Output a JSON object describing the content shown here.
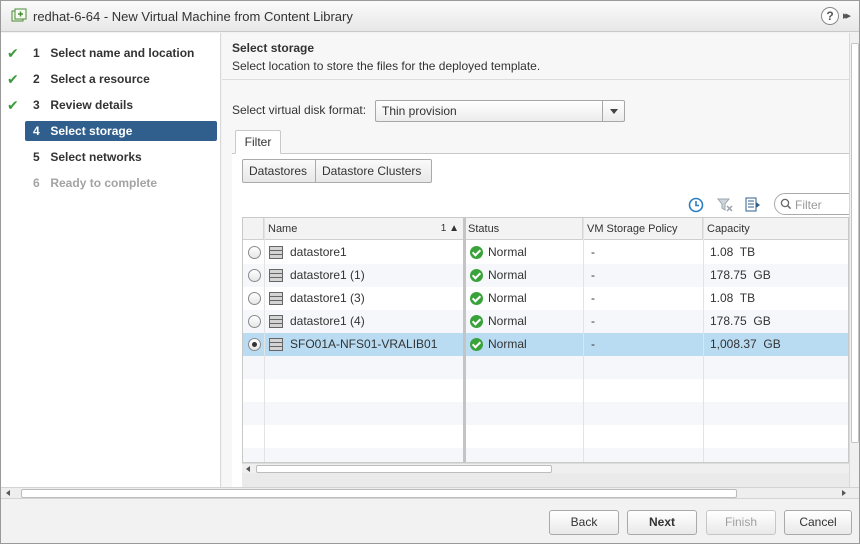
{
  "window": {
    "title": "redhat-6-64 - New Virtual Machine from Content Library",
    "help": "?",
    "expand": "▸▸"
  },
  "nav": {
    "steps": [
      {
        "num": "1",
        "label": "Select name and location",
        "done": true
      },
      {
        "num": "2",
        "label": "Select a resource",
        "done": true
      },
      {
        "num": "3",
        "label": "Review details",
        "done": true
      },
      {
        "num": "4",
        "label": "Select storage",
        "active": true
      },
      {
        "num": "5",
        "label": "Select networks"
      },
      {
        "num": "6",
        "label": "Ready to complete",
        "disabled": true
      }
    ]
  },
  "main": {
    "title": "Select storage",
    "description": "Select location to store the files for the deployed template.",
    "disk_format_label": "Select virtual disk format:",
    "disk_format_value": "Thin provision",
    "tab_filter": "Filter",
    "seg_datastores": "Datastores",
    "seg_clusters": "Datastore Clusters",
    "filter_placeholder": "Filter"
  },
  "grid": {
    "headers": {
      "name": "Name",
      "sort": "1 ▲",
      "status": "Status",
      "policy": "VM Storage Policy",
      "capacity": "Capacity"
    },
    "rows": [
      {
        "name": "datastore1",
        "status": "Normal",
        "policy": "-",
        "capacity": "1.08  TB",
        "selected": false
      },
      {
        "name": "datastore1 (1)",
        "status": "Normal",
        "policy": "-",
        "capacity": "178.75  GB",
        "selected": false
      },
      {
        "name": "datastore1 (3)",
        "status": "Normal",
        "policy": "-",
        "capacity": "1.08  TB",
        "selected": false
      },
      {
        "name": "datastore1 (4)",
        "status": "Normal",
        "policy": "-",
        "capacity": "178.75  GB",
        "selected": false
      },
      {
        "name": "SFO01A-NFS01-VRALIB01",
        "status": "Normal",
        "policy": "-",
        "capacity": "1,008.37  GB",
        "selected": true
      }
    ]
  },
  "footer": {
    "back": "Back",
    "next": "Next",
    "finish": "Finish",
    "cancel": "Cancel"
  },
  "colors": {
    "active_step": "#315f8d",
    "check": "#3b9a3b",
    "selected_row": "#b9dcf3",
    "ok": "#3aa23a"
  }
}
